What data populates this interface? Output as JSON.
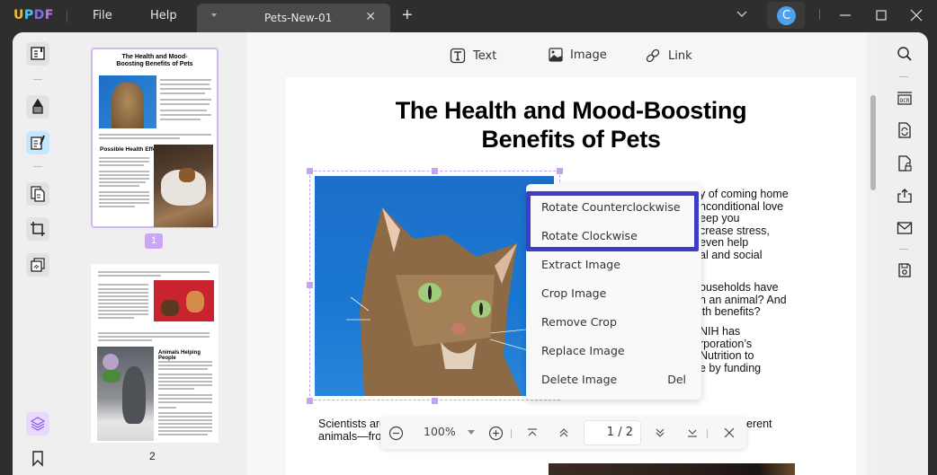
{
  "titlebar": {
    "logo": {
      "u": "U",
      "p": "P",
      "d": "D",
      "f": "F"
    },
    "menu": [
      "File",
      "Help"
    ],
    "tab_name": "Pets-New-01",
    "avatar_initial": "C"
  },
  "toolbar": {
    "tools": [
      {
        "label": "Text",
        "icon": "text-box-icon"
      },
      {
        "label": "Image",
        "icon": "image-icon"
      },
      {
        "label": "Link",
        "icon": "link-icon"
      }
    ]
  },
  "left_sidebar": {
    "items": [
      "reader-icon",
      "comment-icon",
      "edit-pdf-icon",
      "organize-pages-icon",
      "crop-icon",
      "page-tools-icon"
    ],
    "bottom": [
      "layers-icon",
      "bookmark-icon"
    ],
    "active": "edit-pdf-icon"
  },
  "thumbnails": {
    "pages": [
      {
        "label": "1",
        "selected": true
      },
      {
        "label": "2",
        "selected": false
      }
    ],
    "page1_title": "The Health and Mood-Boosting Benefits of Pets",
    "page1_heading": "Possible Health Effects",
    "page2_heading": "Animals Helping People"
  },
  "document": {
    "title_line1": "The Health and Mood-Boosting",
    "title_line2": "Benefits of Pets",
    "right_para1": [
      "y of coming home",
      "nconditional love",
      "eep you",
      "crease stress,",
      "even  help",
      "al and social"
    ],
    "right_para2": [
      "ouseholds have",
      "n an animal? And",
      "lth benefits?"
    ],
    "right_para3": [
      "NIH  has",
      "rporation’s",
      " Nutrition  to",
      "e by funding"
    ],
    "bottom_left": [
      "Scientists are",
      "animals—fro"
    ],
    "bottom_right": "erent"
  },
  "context_menu": {
    "items": [
      {
        "label": "Rotate Counterclockwise",
        "shortcut": ""
      },
      {
        "label": "Rotate Clockwise",
        "shortcut": ""
      },
      {
        "label": "Extract Image",
        "shortcut": ""
      },
      {
        "label": "Crop Image",
        "shortcut": ""
      },
      {
        "label": "Remove Crop",
        "shortcut": ""
      },
      {
        "label": "Replace Image",
        "shortcut": ""
      },
      {
        "label": "Delete Image",
        "shortcut": "Del"
      }
    ],
    "highlighted": [
      "Rotate Counterclockwise",
      "Rotate Clockwise"
    ],
    "highlight_color": "#3d3dc6"
  },
  "zoombar": {
    "zoom": "100%",
    "current_page": "1",
    "page_separator": "/",
    "total_pages": "2"
  },
  "right_sidebar": {
    "items": [
      "search-icon",
      "ocr-icon",
      "convert-icon",
      "protect-icon",
      "share-icon",
      "email-icon",
      "save-icon"
    ]
  },
  "colors": {
    "accent_purple": "#c4a3f5",
    "active_blue": "#c5e6fb",
    "avatar": "#4ba3ee"
  }
}
